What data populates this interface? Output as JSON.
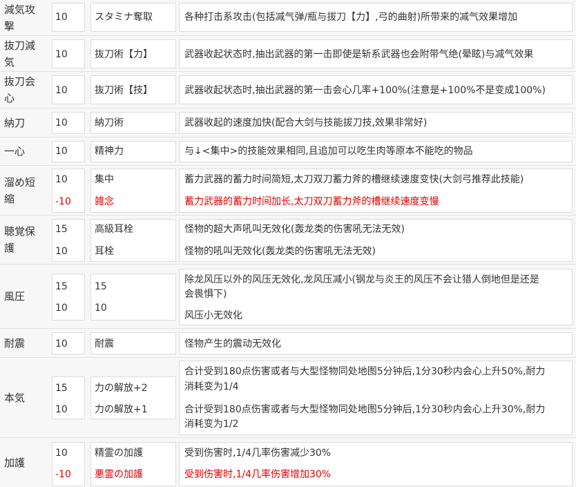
{
  "rows": [
    {
      "name_lines": [
        "減気攻",
        "撃"
      ],
      "entries": [
        {
          "level": "10",
          "skill": "スタミナ奪取",
          "effect": [
            "各种打击系攻击(包括减气弹/瓶与拔刀【力】,弓的曲射)所带来的减气效果增加"
          ]
        }
      ]
    },
    {
      "name_lines": [
        "抜刀減",
        "気"
      ],
      "entries": [
        {
          "level": "10",
          "skill": "抜刀術【力】",
          "effect": [
            "武器收起状态时,抽出武器的第一击即使是斩系武器也会附带气绝(晕眩)与减气效果"
          ]
        }
      ]
    },
    {
      "name_lines": [
        "抜刀会",
        "心"
      ],
      "entries": [
        {
          "level": "10",
          "skill": "抜刀術【技】",
          "effect": [
            "武器收起状态时,抽出武器的第一击会心几率+100%(注意是+100%不是变成100%)"
          ]
        }
      ]
    },
    {
      "name_lines": [
        "納刀"
      ],
      "entries": [
        {
          "level": "10",
          "skill": "納刀術",
          "effect": [
            "武器收起的速度加快(配合大剑与技能拔刀技,效果非常好)"
          ]
        }
      ]
    },
    {
      "name_lines": [
        "一心"
      ],
      "entries": [
        {
          "level": "10",
          "skill": "精神力",
          "effect": [
            "与↓<集中>的技能效果相同,且追加可以吃生肉等原本不能吃的物品"
          ]
        }
      ]
    },
    {
      "name_lines": [
        "溜め短",
        "縮"
      ],
      "entries": [
        {
          "level": "10",
          "skill": "集中",
          "effect": [
            "蓄力武器的蓄力时间简短,太刀双刀蓄力斧的槽继续速度变快(大剑弓推荐此技能)"
          ]
        },
        {
          "level": "-10",
          "skill": "雑念",
          "effect": [
            "蓄力武器的蓄力时间加长,太刀双刀蓄力斧的槽继续速度变慢"
          ],
          "negative": true
        }
      ]
    },
    {
      "name_lines": [
        "聴覚保",
        "護"
      ],
      "entries": [
        {
          "level": "15",
          "skill": "高級耳栓",
          "effect": [
            "怪物的超大声吼叫无效化(轰龙类的伤害吼无法无效)"
          ]
        },
        {
          "level": "10",
          "skill": "耳栓",
          "effect": [
            "怪物的吼叫无效化(轰龙类的伤害吼无法无效)"
          ]
        }
      ]
    },
    {
      "name_lines": [
        "風圧"
      ],
      "entries": [
        {
          "level": "15",
          "skill": "15",
          "effect": [
            "除龙风压以外的风压无效化,龙风压减小(钢龙与炎王的风压不会让猎人倒地但是还是",
            "会畏惧下)"
          ]
        },
        {
          "level": "10",
          "skill": "10",
          "effect": [
            "风压小无效化"
          ]
        }
      ]
    },
    {
      "name_lines": [
        "耐震"
      ],
      "entries": [
        {
          "level": "10",
          "skill": "耐震",
          "effect": [
            "怪物产生的震动无效化"
          ]
        }
      ]
    },
    {
      "name_lines": [
        "本気"
      ],
      "entries": [
        {
          "level": "15",
          "skill": "力の解放+2",
          "effect": [
            "合计受到180点伤害或者与大型怪物同处地图5分钟后,1分30秒内会心上升50%,耐力",
            "消耗变为1/4"
          ]
        },
        {
          "level": "10",
          "skill": "力の解放+1",
          "effect": [
            "合计受到180点伤害或者与大型怪物同处地图5分钟后,1分30秒内会心上升30%,耐力",
            "消耗变为1/2"
          ]
        }
      ]
    },
    {
      "name_lines": [
        "加護"
      ],
      "entries": [
        {
          "level": "10",
          "skill": "精霊の加護",
          "effect": [
            "受到伤害时,1/4几率伤害减少30%"
          ]
        },
        {
          "level": "-10",
          "skill": "悪霊の加護",
          "effect": [
            "受到伤害时,1/4几率伤害增加30%"
          ],
          "negative": true
        }
      ]
    }
  ],
  "colors": {
    "negative": "#e00000",
    "text": "#333333",
    "row_bg": "#f7f7f7",
    "cell_border": "#dcdcdc"
  }
}
